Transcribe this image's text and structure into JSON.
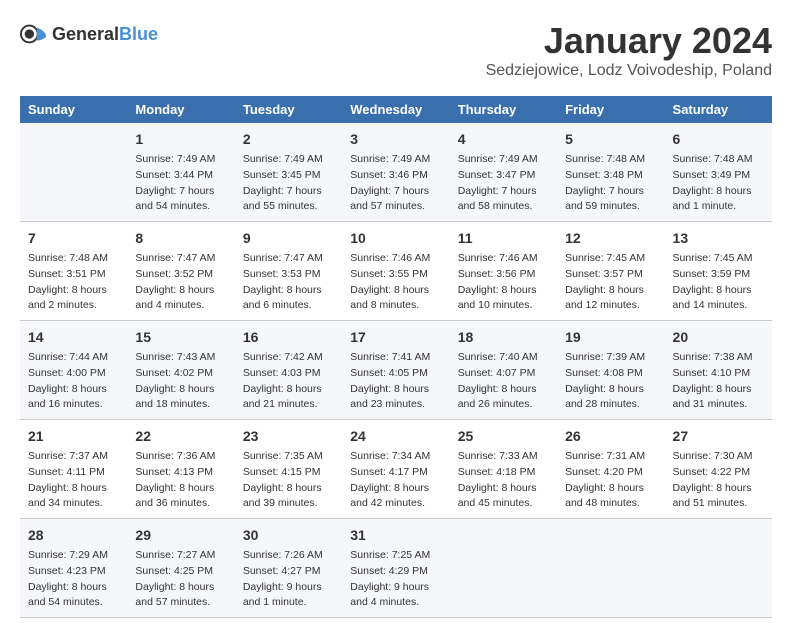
{
  "logo": {
    "general": "General",
    "blue": "Blue"
  },
  "title": "January 2024",
  "subtitle": "Sedziejowice, Lodz Voivodeship, Poland",
  "weekdays": [
    "Sunday",
    "Monday",
    "Tuesday",
    "Wednesday",
    "Thursday",
    "Friday",
    "Saturday"
  ],
  "weeks": [
    [
      {
        "date": "",
        "info": ""
      },
      {
        "date": "1",
        "info": "Sunrise: 7:49 AM\nSunset: 3:44 PM\nDaylight: 7 hours\nand 54 minutes."
      },
      {
        "date": "2",
        "info": "Sunrise: 7:49 AM\nSunset: 3:45 PM\nDaylight: 7 hours\nand 55 minutes."
      },
      {
        "date": "3",
        "info": "Sunrise: 7:49 AM\nSunset: 3:46 PM\nDaylight: 7 hours\nand 57 minutes."
      },
      {
        "date": "4",
        "info": "Sunrise: 7:49 AM\nSunset: 3:47 PM\nDaylight: 7 hours\nand 58 minutes."
      },
      {
        "date": "5",
        "info": "Sunrise: 7:48 AM\nSunset: 3:48 PM\nDaylight: 7 hours\nand 59 minutes."
      },
      {
        "date": "6",
        "info": "Sunrise: 7:48 AM\nSunset: 3:49 PM\nDaylight: 8 hours\nand 1 minute."
      }
    ],
    [
      {
        "date": "7",
        "info": "Sunrise: 7:48 AM\nSunset: 3:51 PM\nDaylight: 8 hours\nand 2 minutes."
      },
      {
        "date": "8",
        "info": "Sunrise: 7:47 AM\nSunset: 3:52 PM\nDaylight: 8 hours\nand 4 minutes."
      },
      {
        "date": "9",
        "info": "Sunrise: 7:47 AM\nSunset: 3:53 PM\nDaylight: 8 hours\nand 6 minutes."
      },
      {
        "date": "10",
        "info": "Sunrise: 7:46 AM\nSunset: 3:55 PM\nDaylight: 8 hours\nand 8 minutes."
      },
      {
        "date": "11",
        "info": "Sunrise: 7:46 AM\nSunset: 3:56 PM\nDaylight: 8 hours\nand 10 minutes."
      },
      {
        "date": "12",
        "info": "Sunrise: 7:45 AM\nSunset: 3:57 PM\nDaylight: 8 hours\nand 12 minutes."
      },
      {
        "date": "13",
        "info": "Sunrise: 7:45 AM\nSunset: 3:59 PM\nDaylight: 8 hours\nand 14 minutes."
      }
    ],
    [
      {
        "date": "14",
        "info": "Sunrise: 7:44 AM\nSunset: 4:00 PM\nDaylight: 8 hours\nand 16 minutes."
      },
      {
        "date": "15",
        "info": "Sunrise: 7:43 AM\nSunset: 4:02 PM\nDaylight: 8 hours\nand 18 minutes."
      },
      {
        "date": "16",
        "info": "Sunrise: 7:42 AM\nSunset: 4:03 PM\nDaylight: 8 hours\nand 21 minutes."
      },
      {
        "date": "17",
        "info": "Sunrise: 7:41 AM\nSunset: 4:05 PM\nDaylight: 8 hours\nand 23 minutes."
      },
      {
        "date": "18",
        "info": "Sunrise: 7:40 AM\nSunset: 4:07 PM\nDaylight: 8 hours\nand 26 minutes."
      },
      {
        "date": "19",
        "info": "Sunrise: 7:39 AM\nSunset: 4:08 PM\nDaylight: 8 hours\nand 28 minutes."
      },
      {
        "date": "20",
        "info": "Sunrise: 7:38 AM\nSunset: 4:10 PM\nDaylight: 8 hours\nand 31 minutes."
      }
    ],
    [
      {
        "date": "21",
        "info": "Sunrise: 7:37 AM\nSunset: 4:11 PM\nDaylight: 8 hours\nand 34 minutes."
      },
      {
        "date": "22",
        "info": "Sunrise: 7:36 AM\nSunset: 4:13 PM\nDaylight: 8 hours\nand 36 minutes."
      },
      {
        "date": "23",
        "info": "Sunrise: 7:35 AM\nSunset: 4:15 PM\nDaylight: 8 hours\nand 39 minutes."
      },
      {
        "date": "24",
        "info": "Sunrise: 7:34 AM\nSunset: 4:17 PM\nDaylight: 8 hours\nand 42 minutes."
      },
      {
        "date": "25",
        "info": "Sunrise: 7:33 AM\nSunset: 4:18 PM\nDaylight: 8 hours\nand 45 minutes."
      },
      {
        "date": "26",
        "info": "Sunrise: 7:31 AM\nSunset: 4:20 PM\nDaylight: 8 hours\nand 48 minutes."
      },
      {
        "date": "27",
        "info": "Sunrise: 7:30 AM\nSunset: 4:22 PM\nDaylight: 8 hours\nand 51 minutes."
      }
    ],
    [
      {
        "date": "28",
        "info": "Sunrise: 7:29 AM\nSunset: 4:23 PM\nDaylight: 8 hours\nand 54 minutes."
      },
      {
        "date": "29",
        "info": "Sunrise: 7:27 AM\nSunset: 4:25 PM\nDaylight: 8 hours\nand 57 minutes."
      },
      {
        "date": "30",
        "info": "Sunrise: 7:26 AM\nSunset: 4:27 PM\nDaylight: 9 hours\nand 1 minute."
      },
      {
        "date": "31",
        "info": "Sunrise: 7:25 AM\nSunset: 4:29 PM\nDaylight: 9 hours\nand 4 minutes."
      },
      {
        "date": "",
        "info": ""
      },
      {
        "date": "",
        "info": ""
      },
      {
        "date": "",
        "info": ""
      }
    ]
  ]
}
